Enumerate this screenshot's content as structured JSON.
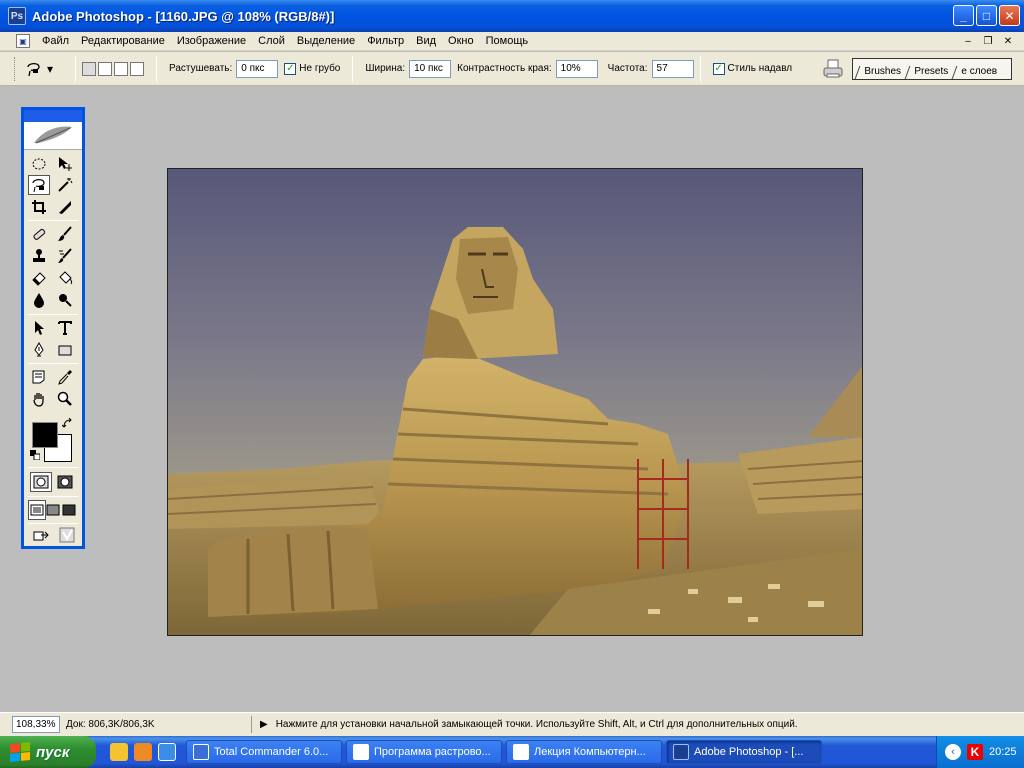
{
  "window": {
    "title": "Adobe Photoshop - [1160.JPG @ 108% (RGB/8#)]",
    "controls": [
      "_",
      "□",
      "✕"
    ]
  },
  "menubar": {
    "items": [
      "Файл",
      "Редактирование",
      "Изображение",
      "Слой",
      "Выделение",
      "Фильтр",
      "Вид",
      "Окно",
      "Помощь"
    ],
    "mdi_controls": [
      "–",
      "❐",
      "✕"
    ]
  },
  "options": {
    "feather_label": "Растушевать:",
    "feather_value": "0 пкс",
    "antialias_label": "Не грубо",
    "antialias_checked": true,
    "width_label": "Ширина:",
    "width_value": "10 пкс",
    "contrast_label": "Контрастность края:",
    "contrast_value": "10%",
    "frequency_label": "Частота:",
    "frequency_value": "57",
    "stylus_label": "Стиль надавл",
    "stylus_checked": true,
    "palette_tabs": [
      "Brushes",
      "Presets",
      "е слоев"
    ]
  },
  "toolbox": {
    "tools": [
      {
        "name": "elliptical-marquee-tool",
        "icon": "ellipse"
      },
      {
        "name": "move-tool",
        "icon": "move"
      },
      {
        "name": "magnetic-lasso-tool",
        "icon": "lasso"
      },
      {
        "name": "magic-wand-tool",
        "icon": "wand"
      },
      {
        "name": "crop-tool",
        "icon": "crop"
      },
      {
        "name": "slice-tool",
        "icon": "slice"
      },
      {
        "name": "healing-brush-tool",
        "icon": "bandage"
      },
      {
        "name": "brush-tool",
        "icon": "brush"
      },
      {
        "name": "clone-stamp-tool",
        "icon": "stamp"
      },
      {
        "name": "history-brush-tool",
        "icon": "history-brush"
      },
      {
        "name": "eraser-tool",
        "icon": "eraser"
      },
      {
        "name": "paint-bucket-tool",
        "icon": "bucket"
      },
      {
        "name": "blur-tool",
        "icon": "drop"
      },
      {
        "name": "burn-tool",
        "icon": "burn"
      },
      {
        "name": "path-selection-tool",
        "icon": "arrow"
      },
      {
        "name": "type-tool",
        "icon": "T"
      },
      {
        "name": "pen-tool",
        "icon": "pen"
      },
      {
        "name": "rectangle-tool",
        "icon": "rect"
      },
      {
        "name": "notes-tool",
        "icon": "note"
      },
      {
        "name": "eyedropper-tool",
        "icon": "eyedropper"
      },
      {
        "name": "hand-tool",
        "icon": "hand"
      },
      {
        "name": "zoom-tool",
        "icon": "zoom"
      }
    ],
    "foreground_color": "#000000",
    "background_color": "#ffffff"
  },
  "status": {
    "zoom": "108,33%",
    "doc": "Док: 806,3K/806,3K",
    "hint": "Нажмите для установки начальной замыкающей точки. Используйте Shift, Alt, и Ctrl для дополнительных опций."
  },
  "taskbar": {
    "start_label": "пуск",
    "tasks": [
      {
        "label": "Total Commander 6.0...",
        "active": false,
        "color": "#3b6fd8"
      },
      {
        "label": "Программа растрово...",
        "active": false,
        "color": "#2b57a8"
      },
      {
        "label": "Лекция Компьютерн...",
        "active": false,
        "color": "#2b57a8"
      },
      {
        "label": "Adobe Photoshop - [...",
        "active": true,
        "color": "#1b3f8f"
      }
    ],
    "clock": "20:25"
  },
  "colors": {
    "title_blue": "#0054e3",
    "face": "#ece9d8",
    "workspace": "#bdbdbd"
  }
}
